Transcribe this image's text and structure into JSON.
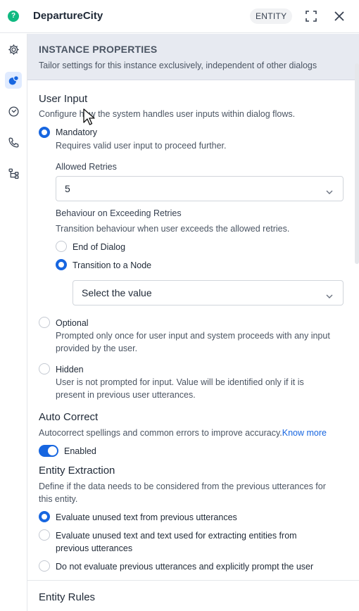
{
  "header": {
    "title": "DepartureCity",
    "badge": "ENTITY"
  },
  "banner": {
    "title": "INSTANCE PROPERTIES",
    "subtitle": "Tailor settings for this instance exclusively, independent of other dialogs"
  },
  "user_input": {
    "heading": "User Input",
    "description": "Configure how the system handles user inputs within dialog flows.",
    "mandatory": {
      "label": "Mandatory",
      "description": "Requires valid user input to proceed further.",
      "selected": true
    },
    "allowed_retries": {
      "label": "Allowed Retries",
      "value": "5"
    },
    "exceeding_retries": {
      "label": "Behaviour on Exceeding Retries",
      "description": "Transition behaviour when user exceeds the allowed retries.",
      "options": [
        {
          "label": "End of Dialog",
          "selected": false
        },
        {
          "label": "Transition to a Node",
          "selected": true
        }
      ],
      "node_select": "Select the value"
    },
    "optional": {
      "label": "Optional",
      "description_line1": "Prompted only once for user input and system proceeds with any input",
      "description_line2": "provided by the user.",
      "selected": false
    },
    "hidden": {
      "label": "Hidden",
      "description_line1": "User is not prompted for input. Value will be identified only if it is",
      "description_line2": "present in previous user utterances.",
      "selected": false
    }
  },
  "auto_correct": {
    "heading": "Auto Correct",
    "description": "Autocorrect spellings and common errors to improve accuracy.",
    "link": "Know more",
    "toggle_label": "Enabled",
    "enabled": true
  },
  "entity_extraction": {
    "heading": "Entity Extraction",
    "description_line1": "Define if the data needs to be considered from the previous utterances for",
    "description_line2": "this entity.",
    "options": [
      {
        "label": "Evaluate unused text from previous utterances",
        "selected": true
      },
      {
        "label": "Evaluate unused text and text used for extracting entities from",
        "label2": "previous utterances",
        "selected": false
      },
      {
        "label": "Do not evaluate previous utterances and explicitly prompt the user",
        "selected": false
      }
    ]
  },
  "entity_rules": {
    "heading": "Entity Rules"
  },
  "colors": {
    "accent": "#1766e0",
    "logo": "#10b981",
    "banner_bg": "#e7eaf1"
  },
  "icons": {
    "logo": "chat-bubble-icon",
    "expand": "expand-icon",
    "close": "close-icon",
    "sidebar": [
      "gear-icon",
      "bubbles-icon",
      "history-icon",
      "phone-icon",
      "flow-icon"
    ]
  }
}
